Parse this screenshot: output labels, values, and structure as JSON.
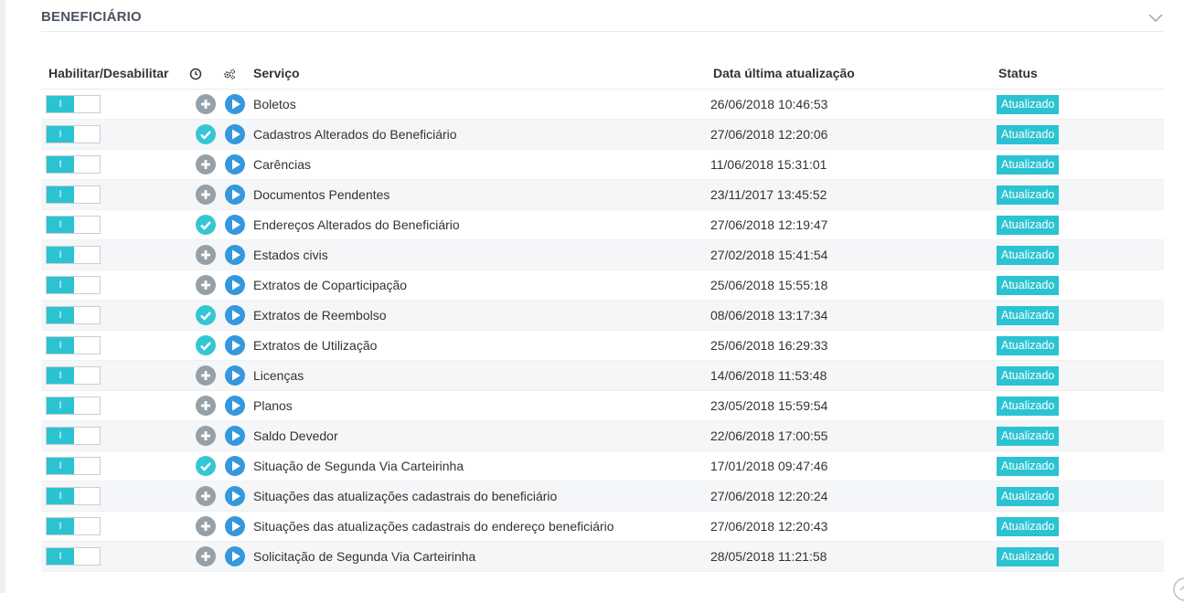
{
  "panel": {
    "title": "BENEFICIÁRIO"
  },
  "table": {
    "headers": {
      "toggle": "Habilitar/Desabilitar",
      "service": "Serviço",
      "date": "Data última atualização",
      "status": "Status"
    },
    "rows": [
      {
        "toggle_label": "I",
        "icon": "plus",
        "service": "Boletos",
        "date": "26/06/2018 10:46:53",
        "status": "Atualizado"
      },
      {
        "toggle_label": "I",
        "icon": "check",
        "service": "Cadastros Alterados do Beneficiário",
        "date": "27/06/2018 12:20:06",
        "status": "Atualizado"
      },
      {
        "toggle_label": "I",
        "icon": "plus",
        "service": "Carências",
        "date": "11/06/2018 15:31:01",
        "status": "Atualizado"
      },
      {
        "toggle_label": "I",
        "icon": "plus",
        "service": "Documentos Pendentes",
        "date": "23/11/2017 13:45:52",
        "status": "Atualizado"
      },
      {
        "toggle_label": "I",
        "icon": "check",
        "service": "Endereços Alterados do Beneficiário",
        "date": "27/06/2018 12:19:47",
        "status": "Atualizado"
      },
      {
        "toggle_label": "I",
        "icon": "plus",
        "service": "Estados civis",
        "date": "27/02/2018 15:41:54",
        "status": "Atualizado"
      },
      {
        "toggle_label": "I",
        "icon": "plus",
        "service": "Extratos de Coparticipação",
        "date": "25/06/2018 15:55:18",
        "status": "Atualizado"
      },
      {
        "toggle_label": "I",
        "icon": "check",
        "service": "Extratos de Reembolso",
        "date": "08/06/2018 13:17:34",
        "status": "Atualizado"
      },
      {
        "toggle_label": "I",
        "icon": "check",
        "service": "Extratos de Utilização",
        "date": "25/06/2018 16:29:33",
        "status": "Atualizado"
      },
      {
        "toggle_label": "I",
        "icon": "plus",
        "service": "Licenças",
        "date": "14/06/2018 11:53:48",
        "status": "Atualizado"
      },
      {
        "toggle_label": "I",
        "icon": "plus",
        "service": "Planos",
        "date": "23/05/2018 15:59:54",
        "status": "Atualizado"
      },
      {
        "toggle_label": "I",
        "icon": "plus",
        "service": "Saldo Devedor",
        "date": "22/06/2018 17:00:55",
        "status": "Atualizado"
      },
      {
        "toggle_label": "I",
        "icon": "check",
        "service": "Situação de Segunda Via Carteirinha",
        "date": "17/01/2018 09:47:46",
        "status": "Atualizado"
      },
      {
        "toggle_label": "I",
        "icon": "plus",
        "service": "Situações das atualizações cadastrais do beneficiário",
        "date": "27/06/2018 12:20:24",
        "status": "Atualizado"
      },
      {
        "toggle_label": "I",
        "icon": "plus",
        "service": "Situações das atualizações cadastrais do endereço beneficiário",
        "date": "27/06/2018 12:20:43",
        "status": "Atualizado"
      },
      {
        "toggle_label": "I",
        "icon": "plus",
        "service": "Solicitação de Segunda Via Carteirinha",
        "date": "28/05/2018 11:21:58",
        "status": "Atualizado"
      }
    ]
  },
  "colors": {
    "accent": "#2bc3d1",
    "play": "#3598dc",
    "plus": "#95a0a8",
    "check": "#36c6d3"
  },
  "icons": {
    "collapse": "chevron-down-icon",
    "header_col2": "clock-icon",
    "header_col3": "gears-icon",
    "plus": "plus-circle-icon",
    "check": "check-circle-icon",
    "play": "play-circle-icon",
    "corner": "arrow-up-circle-icon"
  }
}
